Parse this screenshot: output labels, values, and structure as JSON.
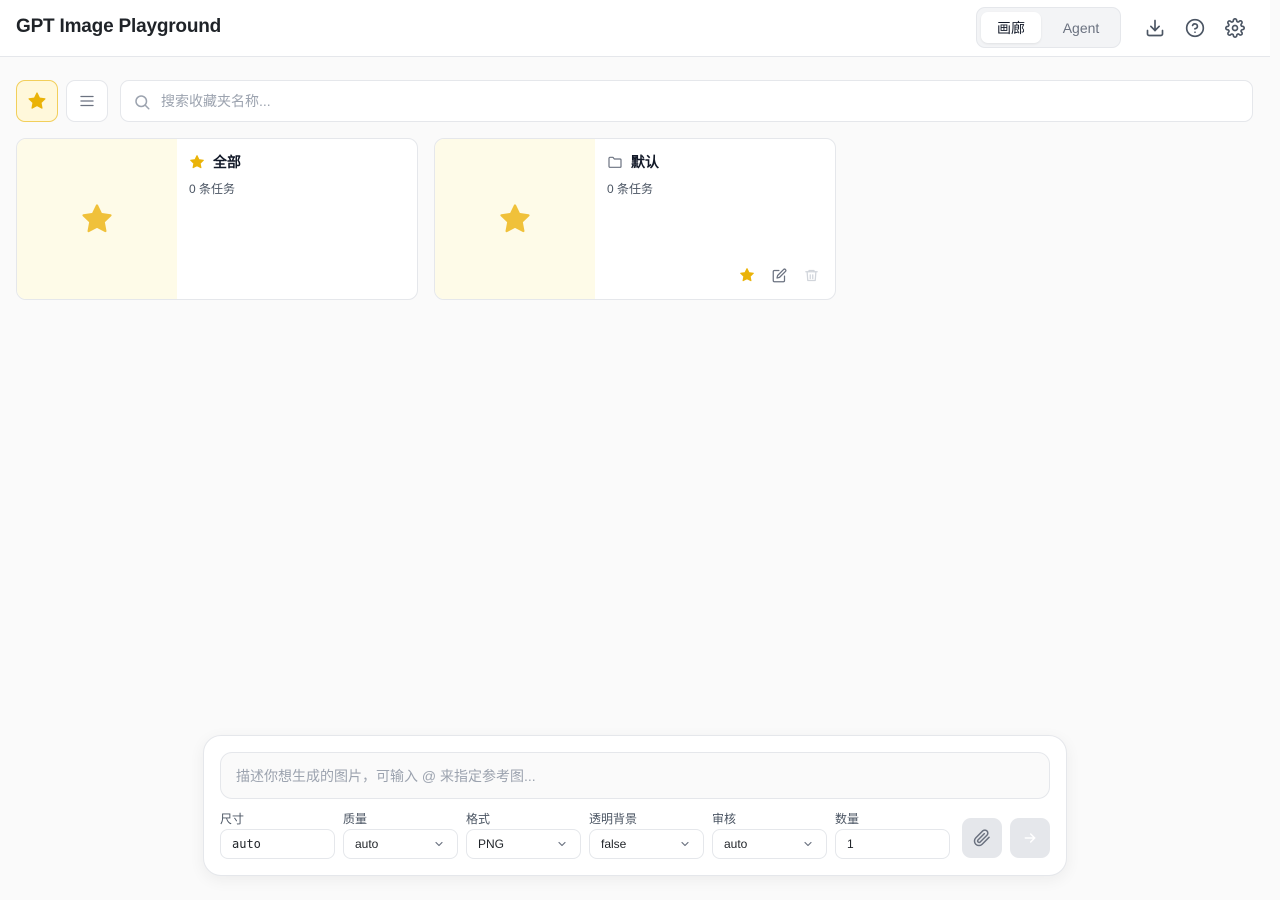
{
  "app": {
    "title": "GPT Image Playground"
  },
  "header": {
    "modes": [
      {
        "label": "画廊",
        "active": true
      },
      {
        "label": "Agent",
        "active": false
      }
    ],
    "icons": [
      "download-icon",
      "help-icon",
      "settings-icon"
    ]
  },
  "toolbar": {
    "favorites_icon": "star-icon",
    "list_icon": "menu-icon",
    "search": {
      "placeholder": "搜索收藏夹名称...",
      "value": ""
    }
  },
  "collections": [
    {
      "name": "全部",
      "count_label": "0 条任务",
      "icon": "star-icon"
    },
    {
      "name": "默认",
      "count_label": "0 条任务",
      "icon": "folder-icon",
      "actions": [
        "star-icon",
        "edit-icon",
        "trash-icon"
      ]
    }
  ],
  "composer": {
    "prompt_placeholder": "描述你想生成的图片，可输入 @ 来指定参考图...",
    "params": [
      {
        "label": "尺寸",
        "value": "auto"
      },
      {
        "label": "质量",
        "value": "auto"
      },
      {
        "label": "格式",
        "value": "PNG"
      },
      {
        "label": "透明背景",
        "value": "false"
      },
      {
        "label": "审核",
        "value": "auto"
      },
      {
        "label": "数量",
        "value": "1"
      }
    ]
  },
  "colors": {
    "accent_star": "#f0c13a",
    "thumb_bg": "#fefbe8",
    "fav_border": "#f2cf5b"
  }
}
